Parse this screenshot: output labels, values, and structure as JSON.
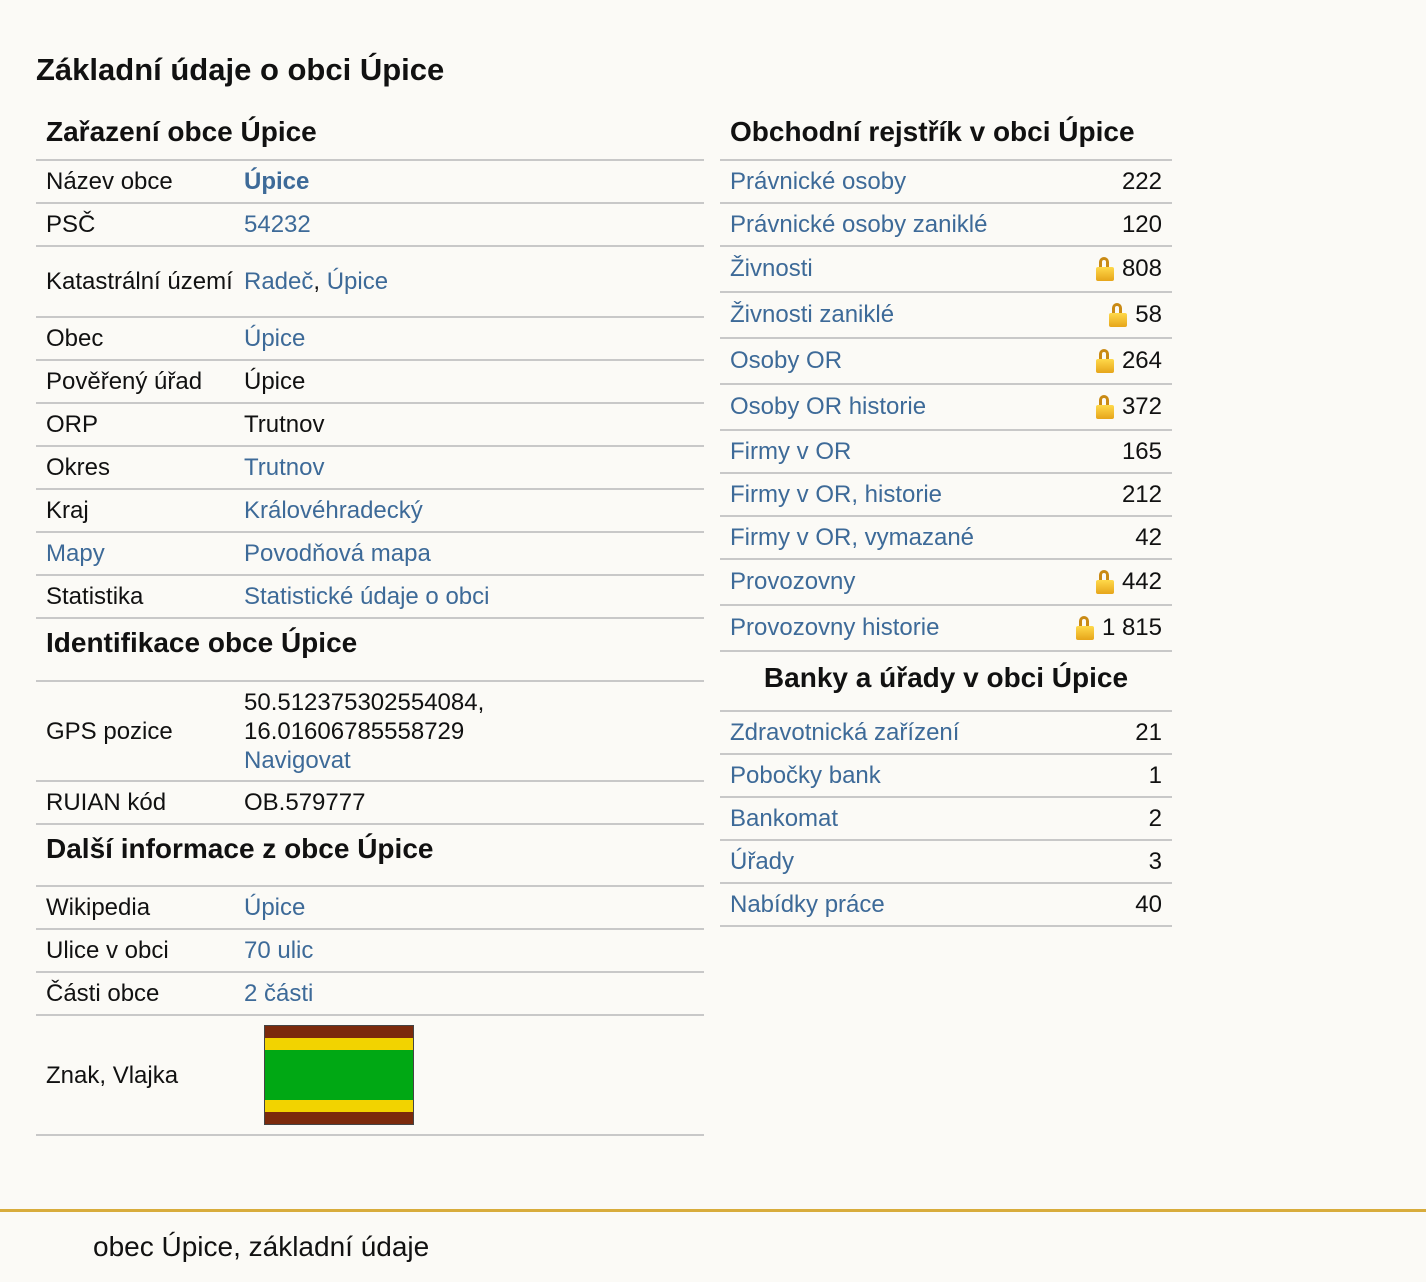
{
  "page_title": "Základní údaje o obci Úpice",
  "zarazeni": {
    "title": "Zařazení obce Úpice",
    "rows": [
      {
        "key": "Název obce",
        "value": "Úpice"
      },
      {
        "key": "PSČ",
        "value": "54232"
      },
      {
        "key": "Katastrální území",
        "value_a": "Radeč",
        "sep": ", ",
        "value_b": "Úpice"
      },
      {
        "key": "Obec",
        "value": "Úpice"
      },
      {
        "key": "Pověřený úřad",
        "value": "Úpice"
      },
      {
        "key": "ORP",
        "value": "Trutnov"
      },
      {
        "key": "Okres",
        "value": "Trutnov"
      },
      {
        "key": "Kraj",
        "value": "Královéhradecký"
      },
      {
        "key": "Mapy",
        "value": "Povodňová mapa"
      },
      {
        "key": "Statistika",
        "value": "Statistické údaje o obci"
      }
    ]
  },
  "identifikace": {
    "title": "Identifikace obce Úpice",
    "gps_key": "GPS pozice",
    "gps_lat": "50.512375302554084,",
    "gps_lon": "16.01606785558729",
    "gps_nav": "Navigovat",
    "ruian_key": "RUIAN kód",
    "ruian_value": "OB.579777"
  },
  "dalsi": {
    "title": "Další informace z obce Úpice",
    "rows": [
      {
        "key": "Wikipedia",
        "value": "Úpice"
      },
      {
        "key": "Ulice v obci",
        "value": "70 ulic"
      },
      {
        "key": "Části obce",
        "value": "2 části"
      }
    ],
    "flag_key": "Znak, Vlajka",
    "flag_colors": {
      "brown": "#7b2a0c",
      "yellow": "#f2d300",
      "green": "#00a814"
    }
  },
  "rejstrik": {
    "title": "Obchodní rejstřík v obci Úpice",
    "rows": [
      {
        "label": "Právnické osoby",
        "value": "222",
        "locked": false
      },
      {
        "label": "Právnické osoby zaniklé",
        "value": "120",
        "locked": false
      },
      {
        "label": "Živnosti",
        "value": "808",
        "locked": true
      },
      {
        "label": "Živnosti zaniklé",
        "value": "58",
        "locked": true
      },
      {
        "label": "Osoby OR",
        "value": "264",
        "locked": true
      },
      {
        "label": "Osoby OR historie",
        "value": "372",
        "locked": true
      },
      {
        "label": "Firmy v OR",
        "value": "165",
        "locked": false
      },
      {
        "label": "Firmy v OR, historie",
        "value": "212",
        "locked": false
      },
      {
        "label": "Firmy v OR, vymazané",
        "value": "42",
        "locked": false
      },
      {
        "label": "Provozovny",
        "value": "442",
        "locked": true
      },
      {
        "label": "Provozovny historie",
        "value": "1 815",
        "locked": true
      }
    ]
  },
  "banky": {
    "title": "Banky a úřady v obci Úpice",
    "rows": [
      {
        "label": "Zdravotnická zařízení",
        "value": "21"
      },
      {
        "label": "Pobočky bank",
        "value": "1"
      },
      {
        "label": "Bankomat",
        "value": "2"
      },
      {
        "label": "Úřady",
        "value": "3"
      },
      {
        "label": "Nabídky práce",
        "value": "40"
      }
    ]
  },
  "footer": "obec Úpice, základní údaje"
}
